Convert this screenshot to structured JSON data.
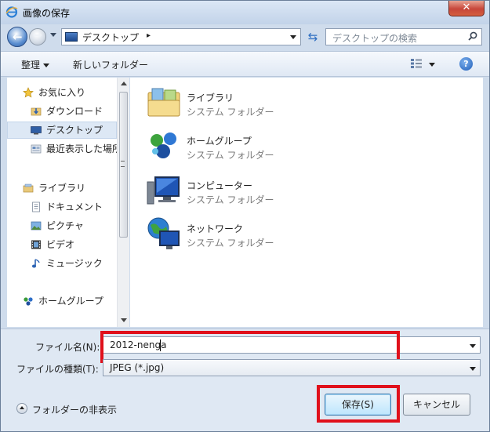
{
  "window": {
    "title": "画像の保存",
    "close_label": "✕"
  },
  "address": {
    "crumb": "デスクトップ",
    "search_placeholder": "デスクトップの検索"
  },
  "toolbar": {
    "organize": "整理",
    "new_folder": "新しいフォルダー",
    "help": "?"
  },
  "nav": {
    "favorites": "お気に入り",
    "downloads": "ダウンロード",
    "desktop": "デスクトップ",
    "recent": "最近表示した場所",
    "libraries": "ライブラリ",
    "documents": "ドキュメント",
    "pictures": "ピクチャ",
    "videos": "ビデオ",
    "music": "ミュージック",
    "homegroup": "ホームグループ"
  },
  "items": [
    {
      "name": "ライブラリ",
      "type": "システム フォルダー"
    },
    {
      "name": "ホームグループ",
      "type": "システム フォルダー"
    },
    {
      "name": "コンピューター",
      "type": "システム フォルダー"
    },
    {
      "name": "ネットワーク",
      "type": "システム フォルダー"
    }
  ],
  "form": {
    "filename_label": "ファイル名(N):",
    "filename_value": "2012-nenga",
    "filetype_label": "ファイルの種類(T):",
    "filetype_value": "JPEG (*.jpg)"
  },
  "footer": {
    "hide_folders": "フォルダーの非表示",
    "save": "保存(S)",
    "cancel": "キャンセル"
  },
  "colors": {
    "highlight": "#e0101b",
    "accent": "#2f6fc2"
  }
}
